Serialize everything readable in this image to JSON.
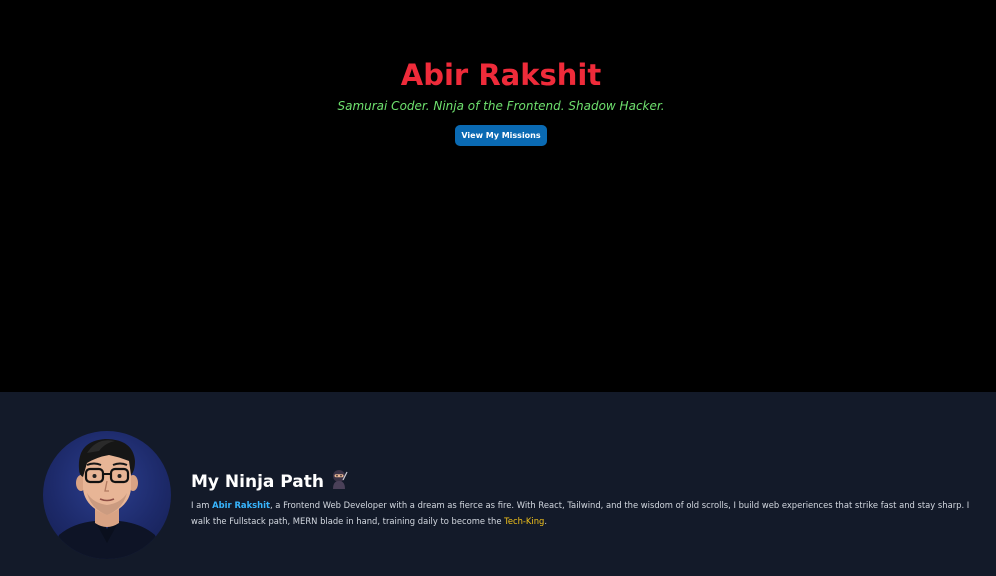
{
  "hero": {
    "title": "Abir Rakshit",
    "subtitle": "Samurai Coder. Ninja of the Frontend. Shadow Hacker.",
    "button_label": "View My Missions",
    "title_color": "#ef2b3a",
    "subtitle_color": "#6ee06e",
    "button_color": "#0a6ab3"
  },
  "about": {
    "heading": "My Ninja Path",
    "heading_icon": "ninja-icon",
    "text_intro": "I am ",
    "name": "Abir Rakshit",
    "text_body": ", a Frontend Web Developer with a dream as fierce as fire. With React, Tailwind, and the wisdom of old scrolls, I build web experiences that strike fast and stay sharp. I walk the Fullstack path, MERN blade in hand, training daily to become the ",
    "tech_king": "Tech-King",
    "text_end": ".",
    "name_color": "#38b6ff",
    "highlight_color": "#f2c21b",
    "background_color": "#131a29"
  }
}
